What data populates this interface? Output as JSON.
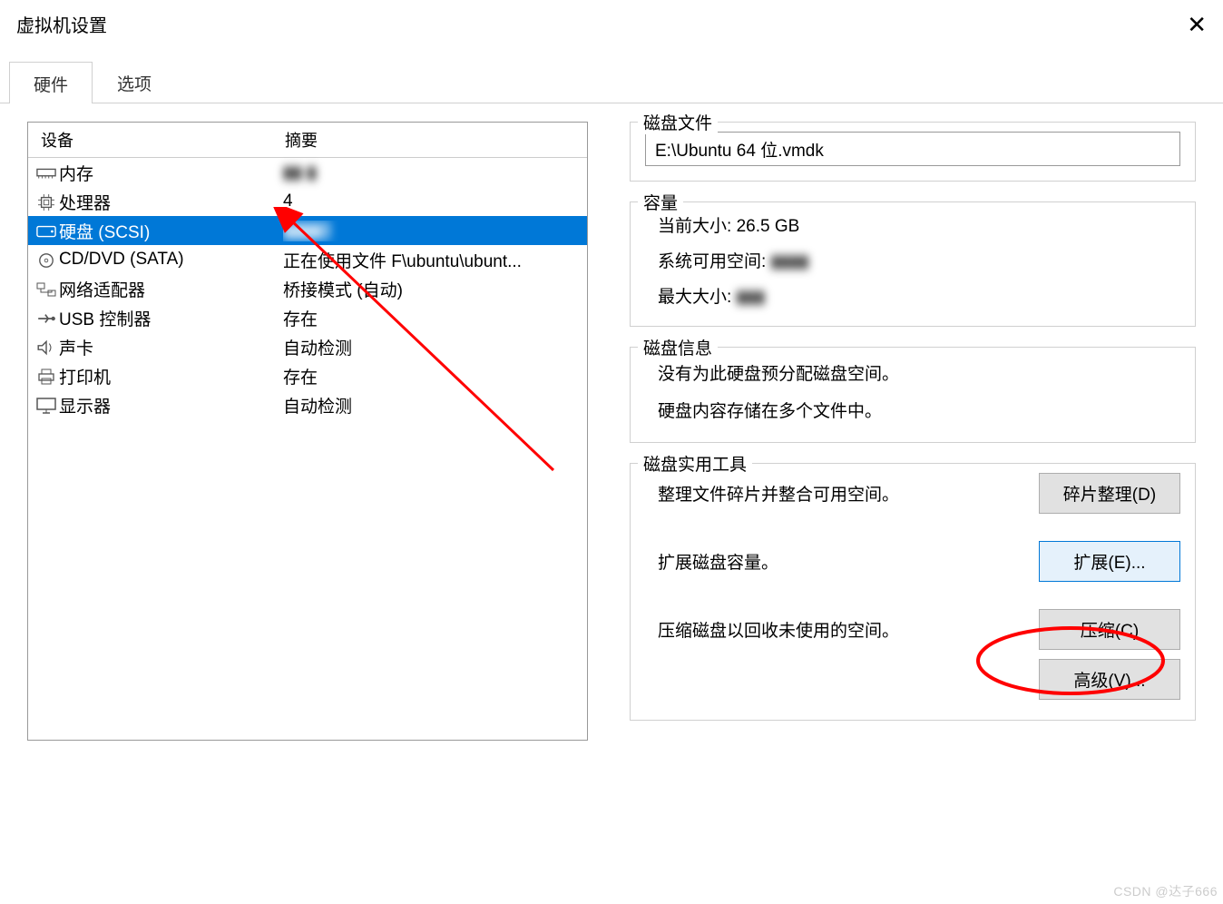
{
  "window": {
    "title": "虚拟机设置"
  },
  "tabs": {
    "hardware": "硬件",
    "options": "选项"
  },
  "device_table": {
    "header_device": "设备",
    "header_summary": "摘要",
    "rows": [
      {
        "name": "内存",
        "summary": "▮▮ ▮"
      },
      {
        "name": "处理器",
        "summary": "4"
      },
      {
        "name": "硬盘 (SCSI)",
        "summary": "▮▮▮▮3"
      },
      {
        "name": "CD/DVD (SATA)",
        "summary": "正在使用文件 F\\ubuntu\\ubunt..."
      },
      {
        "name": "网络适配器",
        "summary": "桥接模式 (自动)"
      },
      {
        "name": "USB 控制器",
        "summary": "存在"
      },
      {
        "name": "声卡",
        "summary": "自动检测"
      },
      {
        "name": "打印机",
        "summary": "存在"
      },
      {
        "name": "显示器",
        "summary": "自动检测"
      }
    ]
  },
  "disk_file": {
    "legend": "磁盘文件",
    "value": "E:\\Ubuntu 64 位.vmdk"
  },
  "capacity": {
    "legend": "容量",
    "current_label": "当前大小:",
    "current_value": "26.5 GB",
    "free_label": "系统可用空间:",
    "free_value": "▮▮▮▮",
    "max_label": "最大大小:",
    "max_value": "▮▮▮"
  },
  "disk_info": {
    "legend": "磁盘信息",
    "line1": "没有为此硬盘预分配磁盘空间。",
    "line2": "硬盘内容存储在多个文件中。"
  },
  "utilities": {
    "legend": "磁盘实用工具",
    "defrag_desc": "整理文件碎片并整合可用空间。",
    "defrag_btn": "碎片整理(D)",
    "expand_desc": "扩展磁盘容量。",
    "expand_btn": "扩展(E)...",
    "compact_desc": "压缩磁盘以回收未使用的空间。",
    "compact_btn": "压缩(C)",
    "advanced_btn": "高级(V)..."
  },
  "watermark": "CSDN @达子666"
}
